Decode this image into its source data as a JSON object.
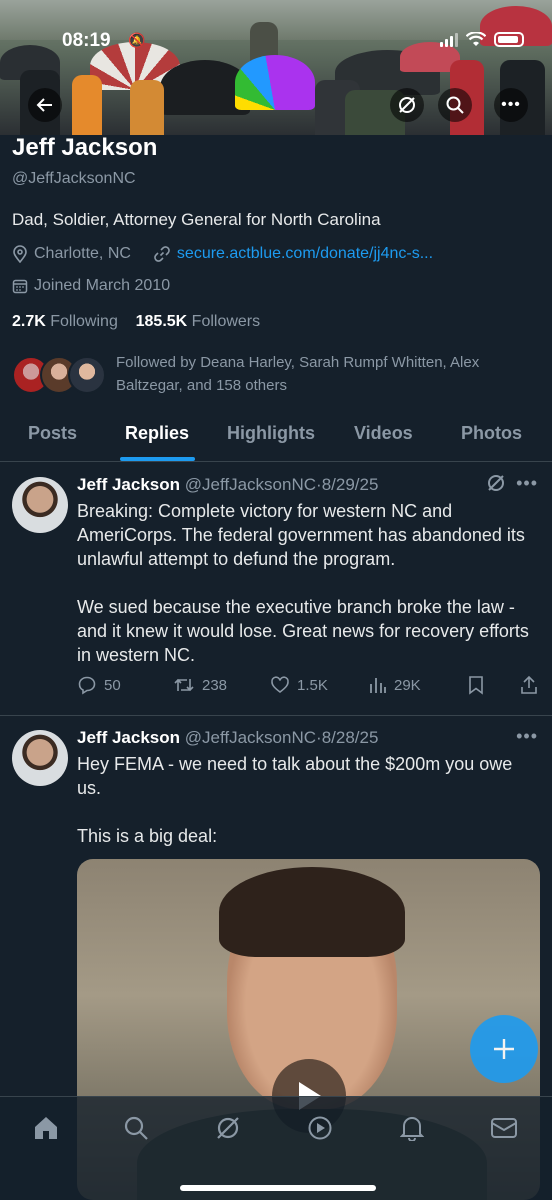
{
  "status_bar": {
    "time": "08:19"
  },
  "header": {
    "back_icon": "arrow-left-icon",
    "grok_icon": "grok-icon",
    "search_icon": "search-icon",
    "more_icon": "more-icon"
  },
  "profile": {
    "name": "Jeff Jackson",
    "handle": "@JeffJacksonNC",
    "bio": "Dad, Soldier, Attorney General for North Carolina",
    "location": "Charlotte, NC",
    "website": "secure.actblue.com/donate/jj4nc-s...",
    "joined": "Joined March 2010",
    "following_count": "2.7K",
    "following_label": "Following",
    "followers_count": "185.5K",
    "followers_label": "Followers",
    "followed_by": "Followed by Deana Harley, Sarah Rumpf Whitten, Alex Baltzegar, and 158 others"
  },
  "tabs": [
    {
      "label": "Posts"
    },
    {
      "label": "Replies"
    },
    {
      "label": "Highlights"
    },
    {
      "label": "Videos"
    },
    {
      "label": "Photos"
    }
  ],
  "active_tab": "Replies",
  "tweets": [
    {
      "name": "Jeff Jackson",
      "handle": "@JeffJacksonNC",
      "date": "8/29/25",
      "text": "Breaking: Complete victory for western NC and AmeriCorps. The federal government has abandoned its unlawful attempt to defund the program.\n\nWe sued because the executive branch broke the law - and it knew it would lose. Great news for recovery efforts in western NC.",
      "replies": "50",
      "reposts": "238",
      "likes": "1.5K",
      "views": "29K"
    },
    {
      "name": "Jeff Jackson",
      "handle": "@JeffJacksonNC",
      "date": "8/28/25",
      "text": "Hey FEMA - we need to talk about the $200m you owe us.\n\nThis is a big deal:"
    }
  ],
  "colors": {
    "background": "#15202b",
    "accent": "#1d9bf0",
    "secondary_text": "#8b98a5",
    "divider": "#38444d"
  },
  "bottom_nav": [
    "home-icon",
    "search-icon",
    "grok-icon",
    "video-icon",
    "notifications-icon",
    "messages-icon"
  ]
}
